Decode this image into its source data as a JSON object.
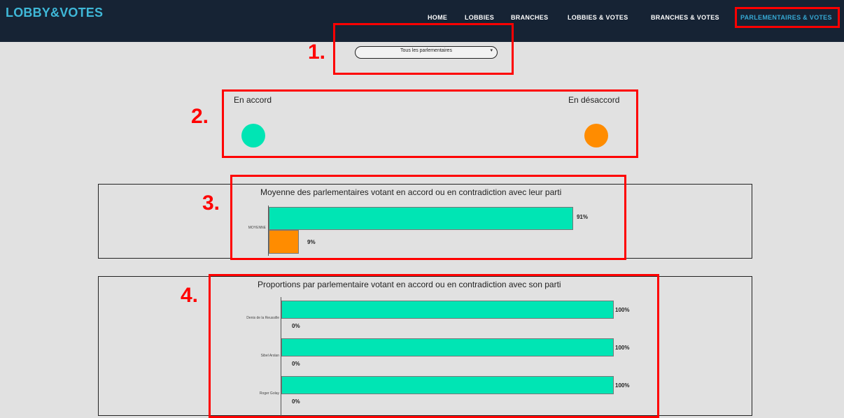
{
  "header": {
    "brand": "LOBBY&VOTES",
    "nav": [
      "HOME",
      "LOBBIES",
      "BRANCHES",
      "LOBBIES & VOTES",
      "BRANCHES & VOTES",
      "PARLEMENTAIRES & VOTES"
    ]
  },
  "annotations": [
    "1.",
    "2.",
    "3.",
    "4."
  ],
  "filter": {
    "selected": "Tous les parlementaires"
  },
  "legend": {
    "agree_label": "En accord",
    "disagree_label": "En désaccord",
    "agree_color": "#00e5b4",
    "disagree_color": "#ff8c00"
  },
  "average_chart": {
    "title": "Moyenne des parlementaires votant en accord ou en contradiction avec leur parti",
    "row_label": "MOYENNE",
    "agree_label": "91%",
    "disagree_label": "9%"
  },
  "members_chart": {
    "title": "Proportions par parlementaire votant en accord ou en contradiction avec son parti",
    "rows": [
      {
        "name": "Denis de la Reussille",
        "agree_label": "100%",
        "disagree_label": "0%"
      },
      {
        "name": "Sibel Arslan",
        "agree_label": "100%",
        "disagree_label": "0%"
      },
      {
        "name": "Roger Golay",
        "agree_label": "100%",
        "disagree_label": "0%"
      }
    ]
  },
  "chart_data": [
    {
      "type": "bar",
      "title": "Moyenne des parlementaires votant en accord ou en contradiction avec leur parti",
      "categories": [
        "MOYENNE"
      ],
      "series": [
        {
          "name": "En accord",
          "values": [
            91
          ]
        },
        {
          "name": "En désaccord",
          "values": [
            9
          ]
        }
      ],
      "xlim": [
        0,
        100
      ]
    },
    {
      "type": "bar",
      "title": "Proportions par parlementaire votant en accord ou en contradiction avec son parti",
      "categories": [
        "Denis de la Reussille",
        "Sibel Arslan",
        "Roger Golay"
      ],
      "series": [
        {
          "name": "En accord",
          "values": [
            100,
            100,
            100
          ]
        },
        {
          "name": "En désaccord",
          "values": [
            0,
            0,
            0
          ]
        }
      ],
      "xlim": [
        0,
        100
      ]
    }
  ]
}
